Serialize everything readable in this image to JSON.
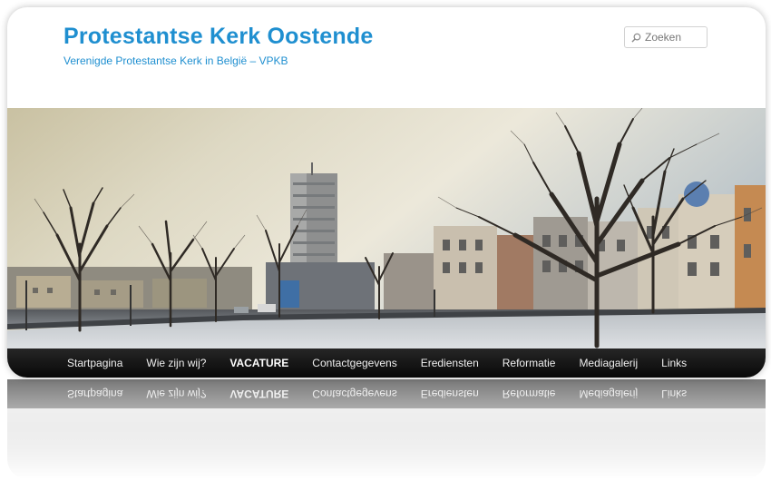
{
  "site": {
    "title": "Protestantse Kerk Oostende",
    "description": "Verenigde Protestantse Kerk in België – VPKB"
  },
  "search": {
    "placeholder": "Zoeken",
    "icon": "search-icon"
  },
  "banner": {
    "description": "photo"
  },
  "nav": {
    "items": [
      {
        "label": "Startpagina"
      },
      {
        "label": "Wie zijn wij?"
      },
      {
        "label": "VACATURE",
        "bold": true
      },
      {
        "label": "Contactgegevens"
      },
      {
        "label": "Erediensten"
      },
      {
        "label": "Reformatie"
      },
      {
        "label": "Mediagalerij"
      },
      {
        "label": "Links"
      }
    ]
  },
  "colors": {
    "title": "#1f8fd0",
    "nav_background": "#111111",
    "nav_text": "#eeeeee"
  }
}
